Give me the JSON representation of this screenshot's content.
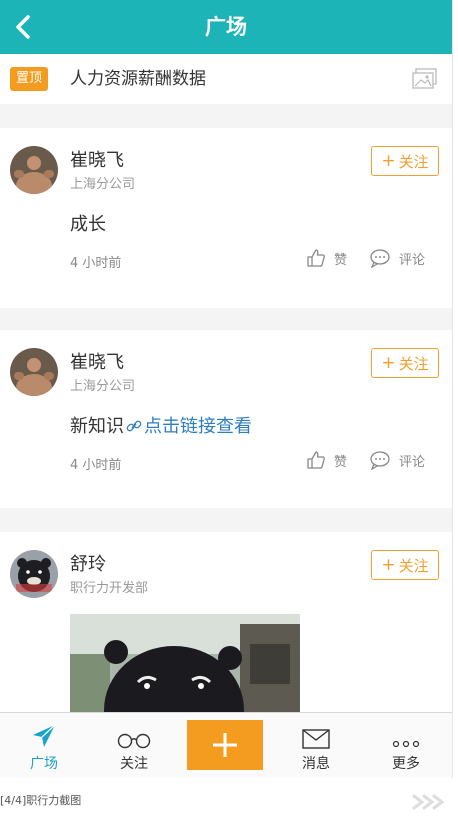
{
  "header": {
    "title": "广场",
    "back_icon": "chevron-left-icon"
  },
  "pinned": {
    "badge": "置顶",
    "title": "人力资源薪酬数据",
    "icon": "image-icon"
  },
  "posts": [
    {
      "author": "崔晓飞",
      "dept": "上海分公司",
      "follow_label": "关注",
      "content": "成长",
      "time": "4 小时前",
      "like_label": "赞",
      "comment_label": "评论"
    },
    {
      "author": "崔晓飞",
      "dept": "上海分公司",
      "follow_label": "关注",
      "content": "新知识",
      "link_text": "点击链接查看",
      "time": "4 小时前",
      "like_label": "赞",
      "comment_label": "评论"
    },
    {
      "author": "舒玲",
      "dept": "职行力开发部",
      "follow_label": "关注"
    }
  ],
  "tabbar": {
    "items": [
      {
        "label": "广场",
        "icon": "send-icon",
        "active": true
      },
      {
        "label": "关注",
        "icon": "glasses-icon"
      },
      {
        "label": "",
        "icon": "plus-icon"
      },
      {
        "label": "消息",
        "icon": "envelope-icon"
      },
      {
        "label": "更多",
        "icon": "more-dots-icon"
      }
    ]
  },
  "caption": "[4/4]职行力截图",
  "colors": {
    "header": "#1db4b8",
    "accent": "#f39c1f",
    "link": "#2d7ec0",
    "active_tab": "#1ba2c7"
  }
}
